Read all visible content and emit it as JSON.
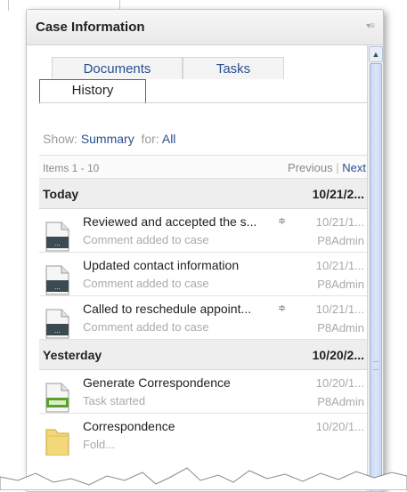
{
  "panel": {
    "title": "Case Information",
    "menu_icon": "panel-menu-icon"
  },
  "tabs": [
    {
      "label": "Documents",
      "active": false
    },
    {
      "label": "Tasks",
      "active": false
    },
    {
      "label": "History",
      "active": true
    }
  ],
  "filter": {
    "show_label": "Show:",
    "show_value": "Summary",
    "for_label": "for:",
    "for_value": "All"
  },
  "pager": {
    "items_text": "Items 1 - 10",
    "previous": "Previous",
    "separator": "|",
    "next": "Next"
  },
  "groups": [
    {
      "label": "Today",
      "date": "10/21/2...",
      "entries": [
        {
          "title": "Reviewed and accepted the s...",
          "subtitle": "Comment added to case",
          "date": "10/21/1...",
          "user": "P8Admin",
          "has_more": true,
          "icon": "document-icon"
        },
        {
          "title": "Updated contact information",
          "subtitle": "Comment added to case",
          "date": "10/21/1...",
          "user": "P8Admin",
          "has_more": false,
          "icon": "document-icon"
        },
        {
          "title": "Called to reschedule appoint...",
          "subtitle": "Comment added to case",
          "date": "10/21/1...",
          "user": "P8Admin",
          "has_more": true,
          "icon": "document-icon"
        }
      ]
    },
    {
      "label": "Yesterday",
      "date": "10/20/2...",
      "entries": [
        {
          "title": "Generate Correspondence",
          "subtitle": "Task started",
          "date": "10/20/1...",
          "user": "P8Admin",
          "has_more": false,
          "icon": "task-document-icon"
        },
        {
          "title": "Correspondence",
          "subtitle": "Fold...",
          "date": "10/20/1...",
          "user": "",
          "has_more": false,
          "icon": "folder-icon"
        }
      ]
    }
  ],
  "colors": {
    "link": "#2a4f8f",
    "muted": "#aaaaaa",
    "group_bg": "#eeeeee",
    "task_green": "#5aa02c"
  }
}
